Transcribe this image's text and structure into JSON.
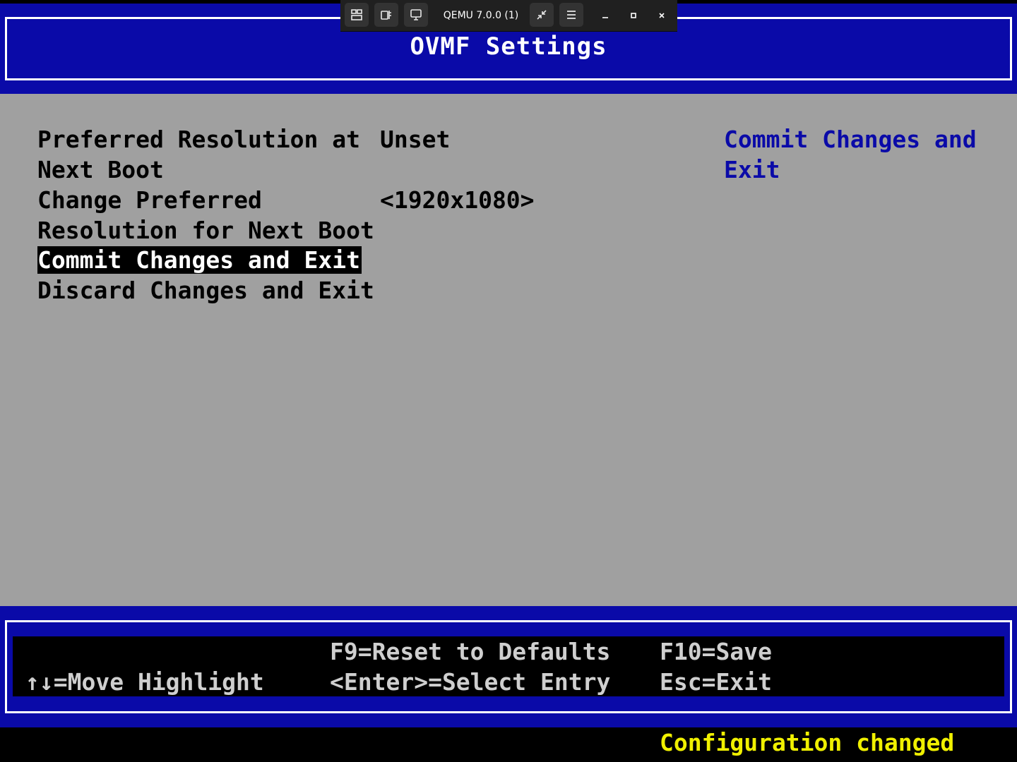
{
  "toolbar": {
    "title": "QEMU 7.0.0 (1)",
    "icons": [
      "view-tabs-icon",
      "usb-devices-icon",
      "display-icon",
      "unfullscreen-icon",
      "hamburger-menu-icon",
      "minimize-icon",
      "maximize-icon",
      "close-icon"
    ]
  },
  "header": {
    "title": "OVMF Settings"
  },
  "menu": {
    "items": [
      {
        "label_lines": [
          "Preferred Resolution at",
          "Next Boot"
        ],
        "value": "Unset"
      },
      {
        "label_lines": [
          "Change Preferred",
          "Resolution for Next Boot"
        ],
        "value": "<1920x1080>"
      },
      {
        "label": "Commit Changes and Exit",
        "selected": true
      },
      {
        "label": "Discard Changes and Exit"
      }
    ]
  },
  "help": {
    "lines": [
      "Commit Changes and",
      "Exit"
    ]
  },
  "footer": {
    "move_highlight": "↑↓=Move Highlight",
    "reset_defaults": "F9=Reset to Defaults",
    "select_entry": "<Enter>=Select Entry",
    "save": "F10=Save",
    "exit": "Esc=Exit"
  },
  "status": {
    "text": "Configuration changed"
  },
  "colors": {
    "header_blue": "#0a0aa8",
    "body_gray": "#a0a0a0",
    "status_yellow": "#f0f000",
    "help_blue": "#0a0aa8"
  }
}
